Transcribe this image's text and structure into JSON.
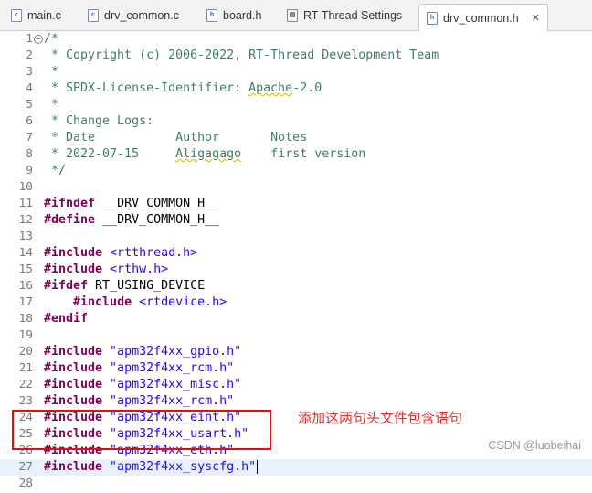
{
  "tabs": [
    {
      "label": "main.c",
      "icon": "c-file-icon",
      "icon_text": "c"
    },
    {
      "label": "drv_common.c",
      "icon": "c-file-icon",
      "icon_text": "c"
    },
    {
      "label": "board.h",
      "icon": "h-file-icon",
      "icon_text": "h"
    },
    {
      "label": "RT-Thread Settings",
      "icon": "settings-file-icon",
      "icon_text": "▤"
    },
    {
      "label": "drv_common.h",
      "icon": "h-file-icon",
      "icon_text": "h",
      "active": true,
      "close": "✕"
    }
  ],
  "fold_marker": "−",
  "lines": [
    {
      "n": "1",
      "tokens": [
        {
          "t": "/*",
          "c": "comment"
        }
      ]
    },
    {
      "n": "2",
      "tokens": [
        {
          "t": " * Copyright (c) 2006-2022, RT-Thread Development Team",
          "c": "comment"
        }
      ]
    },
    {
      "n": "3",
      "tokens": [
        {
          "t": " *",
          "c": "comment"
        }
      ]
    },
    {
      "n": "4",
      "tokens": [
        {
          "t": " * SPDX-License-Identifier: ",
          "c": "comment"
        },
        {
          "t": "Apache",
          "c": "comment",
          "u": true
        },
        {
          "t": "-2.0",
          "c": "comment"
        }
      ]
    },
    {
      "n": "5",
      "tokens": [
        {
          "t": " *",
          "c": "comment"
        }
      ]
    },
    {
      "n": "6",
      "tokens": [
        {
          "t": " * Change Logs:",
          "c": "comment"
        }
      ]
    },
    {
      "n": "7",
      "tokens": [
        {
          "t": " * Date           Author       Notes",
          "c": "comment"
        }
      ]
    },
    {
      "n": "8",
      "tokens": [
        {
          "t": " * 2022-07-15     ",
          "c": "comment"
        },
        {
          "t": "Aligagago",
          "c": "comment",
          "u": true
        },
        {
          "t": "    first version",
          "c": "comment"
        }
      ]
    },
    {
      "n": "9",
      "tokens": [
        {
          "t": " */",
          "c": "comment"
        }
      ]
    },
    {
      "n": "10",
      "tokens": []
    },
    {
      "n": "11",
      "tokens": [
        {
          "t": "#ifndef",
          "c": "kw"
        },
        {
          "t": " __DRV_COMMON_H__",
          "c": "plain"
        }
      ]
    },
    {
      "n": "12",
      "tokens": [
        {
          "t": "#define",
          "c": "kw"
        },
        {
          "t": " __DRV_COMMON_H__",
          "c": "plain"
        }
      ]
    },
    {
      "n": "13",
      "tokens": []
    },
    {
      "n": "14",
      "tokens": [
        {
          "t": "#include",
          "c": "kw"
        },
        {
          "t": " <rtthread.h>",
          "c": "str"
        }
      ]
    },
    {
      "n": "15",
      "tokens": [
        {
          "t": "#include",
          "c": "kw"
        },
        {
          "t": " <rthw.h>",
          "c": "str"
        }
      ]
    },
    {
      "n": "16",
      "tokens": [
        {
          "t": "#ifdef",
          "c": "kw"
        },
        {
          "t": " RT_USING_DEVICE",
          "c": "plain"
        }
      ]
    },
    {
      "n": "17",
      "tokens": [
        {
          "t": "    ",
          "c": "plain"
        },
        {
          "t": "#include",
          "c": "kw"
        },
        {
          "t": " <rtdevice.h>",
          "c": "str"
        }
      ]
    },
    {
      "n": "18",
      "tokens": [
        {
          "t": "#endif",
          "c": "kw"
        }
      ]
    },
    {
      "n": "19",
      "tokens": []
    },
    {
      "n": "20",
      "tokens": [
        {
          "t": "#include",
          "c": "kw"
        },
        {
          "t": " \"apm32f4xx_gpio.h\"",
          "c": "str"
        }
      ]
    },
    {
      "n": "21",
      "tokens": [
        {
          "t": "#include",
          "c": "kw"
        },
        {
          "t": " \"apm32f4xx_rcm.h\"",
          "c": "str"
        }
      ]
    },
    {
      "n": "22",
      "tokens": [
        {
          "t": "#include",
          "c": "kw"
        },
        {
          "t": " \"apm32f4xx_misc.h\"",
          "c": "str"
        }
      ]
    },
    {
      "n": "23",
      "tokens": [
        {
          "t": "#include",
          "c": "kw"
        },
        {
          "t": " \"apm32f4xx_rcm.h\"",
          "c": "str"
        }
      ]
    },
    {
      "n": "24",
      "tokens": [
        {
          "t": "#include",
          "c": "kw"
        },
        {
          "t": " \"apm32f4xx_eint.h\"",
          "c": "str"
        }
      ]
    },
    {
      "n": "25",
      "tokens": [
        {
          "t": "#include",
          "c": "kw"
        },
        {
          "t": " \"apm32f4xx_usart.h\"",
          "c": "str"
        }
      ]
    },
    {
      "n": "26",
      "tokens": [
        {
          "t": "#include",
          "c": "kw"
        },
        {
          "t": " \"apm32f4xx_eth.h\"",
          "c": "str"
        }
      ]
    },
    {
      "n": "27",
      "tokens": [
        {
          "t": "#include",
          "c": "kw"
        },
        {
          "t": " \"apm32f4xx_syscfg.h\"",
          "c": "str"
        }
      ],
      "current": true,
      "cursor": true
    },
    {
      "n": "28",
      "tokens": []
    }
  ],
  "annotation": {
    "text": "添加这两句头文件包含语句",
    "color": "#e01010"
  },
  "watermark": "CSDN @luobeihai",
  "colors": {
    "keyword": "#7f0055",
    "string": "#2a00ff",
    "comment": "#3f7f5f",
    "current_line": "#e8f2fe"
  }
}
